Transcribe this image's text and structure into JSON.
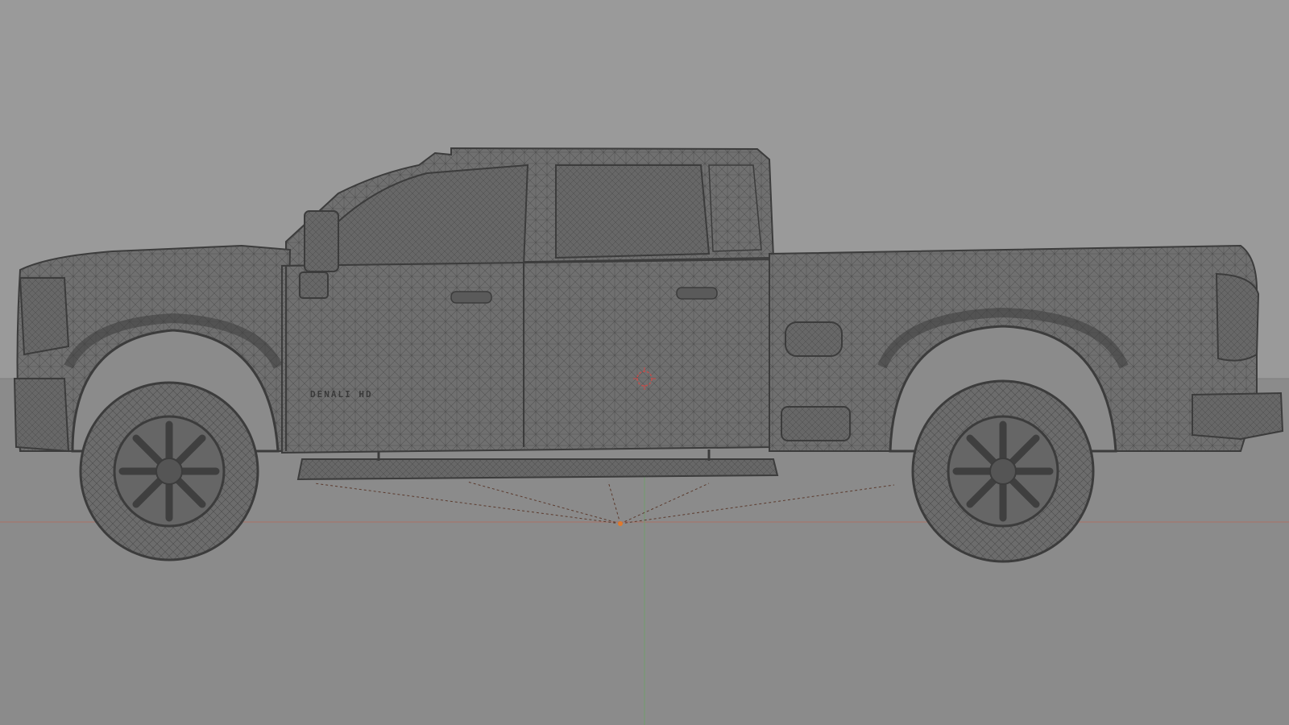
{
  "viewport": {
    "background_color": "#9a9a9a",
    "floor_color": "#8b8b8b",
    "horizon_line_color": "#7d7d7d"
  },
  "scene": {
    "object": "pickup-truck-wireframe",
    "badge_text": "DENALI HD",
    "mesh_color": "#6e6e6e",
    "wire_color": "#4a4a4a",
    "outline_color": "#3c3c3c",
    "tire_color": "#6a6a6a",
    "wheel_color": "#4c4c4c"
  },
  "gizmos": {
    "x_axis_color": "#b06a5e",
    "y_axis_color": "#6fa06a",
    "origin_color": "#e07a2e",
    "light_guide_color": "#5b3b2e",
    "cursor_color": "#c0504d"
  }
}
